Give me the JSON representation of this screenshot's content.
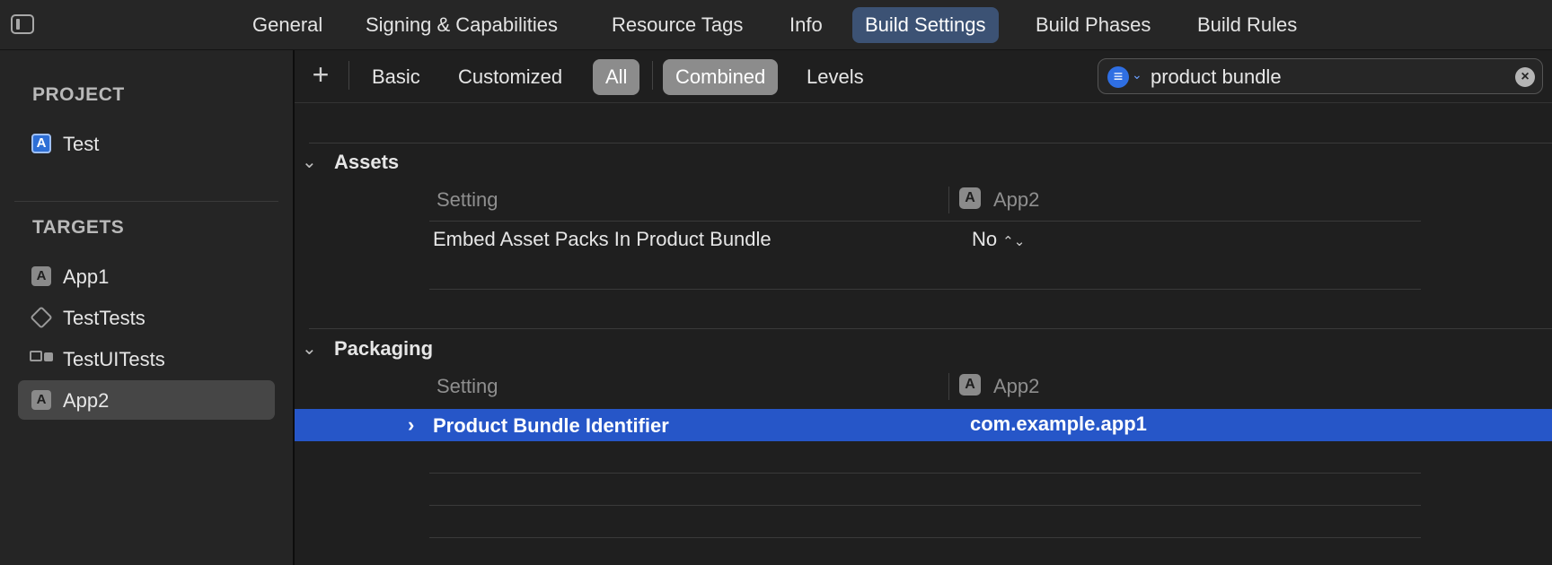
{
  "tabs": [
    {
      "label": "General",
      "active": false
    },
    {
      "label": "Signing & Capabilities",
      "active": false
    },
    {
      "label": "Resource Tags",
      "active": false
    },
    {
      "label": "Info",
      "active": false
    },
    {
      "label": "Build Settings",
      "active": true
    },
    {
      "label": "Build Phases",
      "active": false
    },
    {
      "label": "Build Rules",
      "active": false
    }
  ],
  "sidebar": {
    "project_header": "PROJECT",
    "project_items": [
      {
        "label": "Test",
        "icon": "project-icon"
      }
    ],
    "targets_header": "TARGETS",
    "target_items": [
      {
        "label": "App1",
        "icon": "app-target-icon",
        "selected": false
      },
      {
        "label": "TestTests",
        "icon": "unit-test-icon",
        "selected": false
      },
      {
        "label": "TestUITests",
        "icon": "ui-test-icon",
        "selected": false
      },
      {
        "label": "App2",
        "icon": "app-target-icon",
        "selected": true
      }
    ]
  },
  "filterbar": {
    "add_label": "+",
    "filters": [
      {
        "label": "Basic",
        "active": false
      },
      {
        "label": "Customized",
        "active": false
      },
      {
        "label": "All",
        "active": true
      }
    ],
    "views": [
      {
        "label": "Combined",
        "active": true
      },
      {
        "label": "Levels",
        "active": false
      }
    ],
    "search": {
      "value": "product bundle",
      "icon": "filter-icon",
      "clear_icon": "clear-icon"
    }
  },
  "groups": [
    {
      "title": "Assets",
      "column_setting": "Setting",
      "column_target": "App2",
      "rows": [
        {
          "name": "Embed Asset Packs In Product Bundle",
          "value": "No",
          "stepper": "⌃⌄",
          "selected": false
        }
      ]
    },
    {
      "title": "Packaging",
      "column_setting": "Setting",
      "column_target": "App2",
      "rows": [
        {
          "name": "Product Bundle Identifier",
          "value": "com.example.app1",
          "selected": true
        }
      ]
    }
  ],
  "colors": {
    "accent_tab": "#3c5274",
    "selection": "#2656c8",
    "filter_blue": "#2f6fe3"
  }
}
